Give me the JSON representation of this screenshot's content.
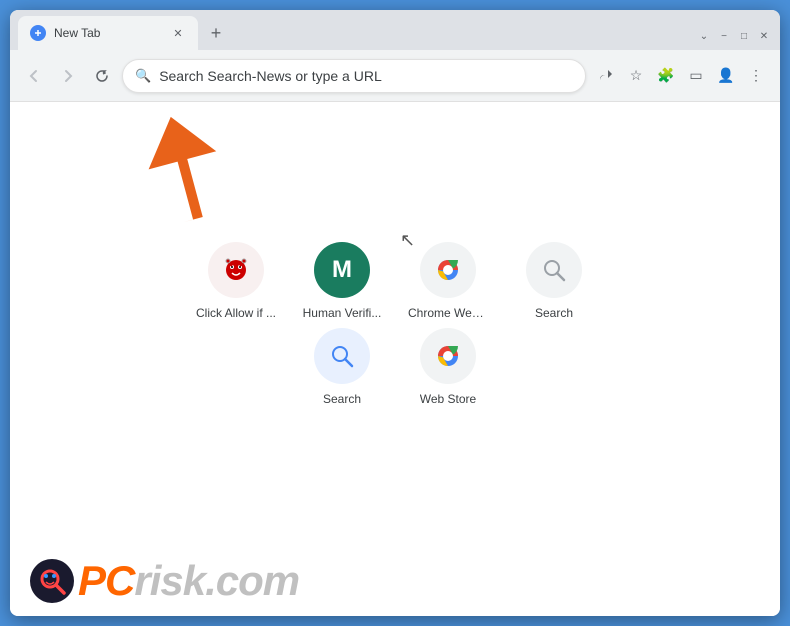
{
  "browser": {
    "tab_title": "New Tab",
    "address_bar": {
      "placeholder": "Search Search-News or type a URL",
      "value": "Search Search-News or type a URL"
    },
    "window_controls": {
      "minimize": "−",
      "maximize": "□",
      "close": "✕",
      "collapse": "⌄"
    }
  },
  "shortcuts": {
    "row1": [
      {
        "id": "click-allow",
        "label": "Click Allow if ...",
        "icon_type": "bug"
      },
      {
        "id": "human-verif",
        "label": "Human Verifi...",
        "icon_type": "m"
      },
      {
        "id": "chrome-web",
        "label": "Chrome Web ...",
        "icon_type": "chrome"
      },
      {
        "id": "search1",
        "label": "Search",
        "icon_type": "search-gray"
      }
    ],
    "row2": [
      {
        "id": "search2",
        "label": "Search",
        "icon_type": "search-blue"
      },
      {
        "id": "web-store",
        "label": "Web Store",
        "icon_type": "chrome2"
      }
    ]
  },
  "watermark": {
    "text_gray": "risk.com",
    "text_orange": "PC"
  }
}
